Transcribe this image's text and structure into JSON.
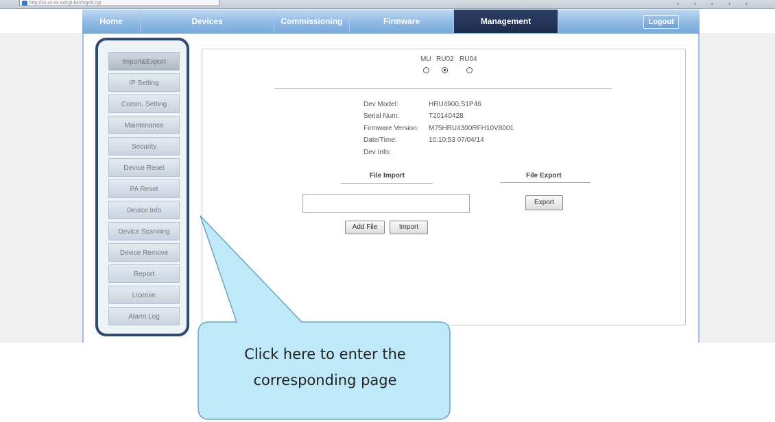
{
  "browser": {
    "address": "http://xx.xx.xx.xx/cgi-bin/mgmt.cgi",
    "toolbar_icons": "▪ ▪ ▪ ▪ ▪"
  },
  "nav": {
    "tabs": [
      {
        "label": "Home"
      },
      {
        "label": "Devices"
      },
      {
        "label": "Commissioning"
      },
      {
        "label": "Firmware"
      },
      {
        "label": "Management",
        "active": true
      }
    ],
    "logout_label": "Logout"
  },
  "sidebar": {
    "items": [
      {
        "label": "Import&Export",
        "active": true
      },
      {
        "label": "IP Setting"
      },
      {
        "label": "Comm. Setting"
      },
      {
        "label": "Maintenance"
      },
      {
        "label": "Security"
      },
      {
        "label": "Device Reset"
      },
      {
        "label": "PA Reset"
      },
      {
        "label": "Device Info"
      },
      {
        "label": "Device Scanning"
      },
      {
        "label": "Device Remove"
      },
      {
        "label": "Report"
      },
      {
        "label": "License"
      },
      {
        "label": "Alarm Log"
      }
    ]
  },
  "unit_select": {
    "options": [
      {
        "label": "MU",
        "checked": false
      },
      {
        "label": "RU02",
        "checked": true
      },
      {
        "label": "RU04",
        "checked": false
      }
    ]
  },
  "device_info": {
    "rows": [
      {
        "label": "Dev Model:",
        "value": "HRU4900,S1P46"
      },
      {
        "label": "Serial Num:",
        "value": "T20140428"
      },
      {
        "label": "Firmware Version:",
        "value": "M75HRU4300RFH10V8001"
      },
      {
        "label": "Date/Time:",
        "value": "10:10:53 07/04/14"
      },
      {
        "label": "Dev Info:",
        "value": ""
      }
    ]
  },
  "file_import": {
    "title": "File Import",
    "file_path_value": "",
    "add_file_label": "Add File",
    "import_label": "Import"
  },
  "file_export": {
    "title": "File Export",
    "export_label": "Export"
  },
  "callout": {
    "line1": "Click here to enter the",
    "line2": "corresponding page",
    "fill_color": "#bfe9f8",
    "border_color": "#6aa6bf"
  },
  "colors": {
    "nav_active": "#1f2d4d",
    "sidebar_outline": "#2e4a73"
  }
}
